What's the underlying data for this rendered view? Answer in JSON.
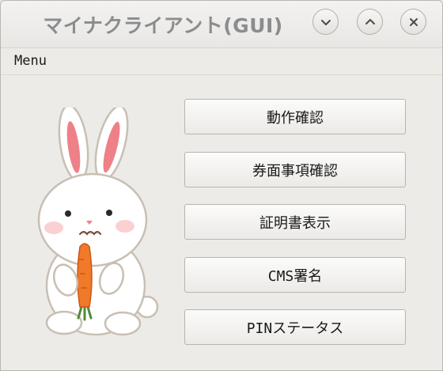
{
  "window": {
    "title": "マイナクライアント(GUI)"
  },
  "titlebar_buttons": [
    {
      "icon": "chevron-down-icon",
      "action": "minimize"
    },
    {
      "icon": "chevron-up-icon",
      "action": "maximize"
    },
    {
      "icon": "close-icon",
      "action": "close"
    }
  ],
  "menubar": {
    "menu_label": "Menu"
  },
  "buttons": {
    "operation_check": "動作確認",
    "ticket_check": "券面事項確認",
    "certificate_display": "証明書表示",
    "cms_sign": "CMS署名",
    "pin_status": "PINステータス"
  },
  "illustration": {
    "icon": "rabbit-with-carrot-icon"
  },
  "colors": {
    "window_bg": "#edebe8",
    "title_text": "#8a8c8e",
    "button_text": "#1a1a1a"
  }
}
